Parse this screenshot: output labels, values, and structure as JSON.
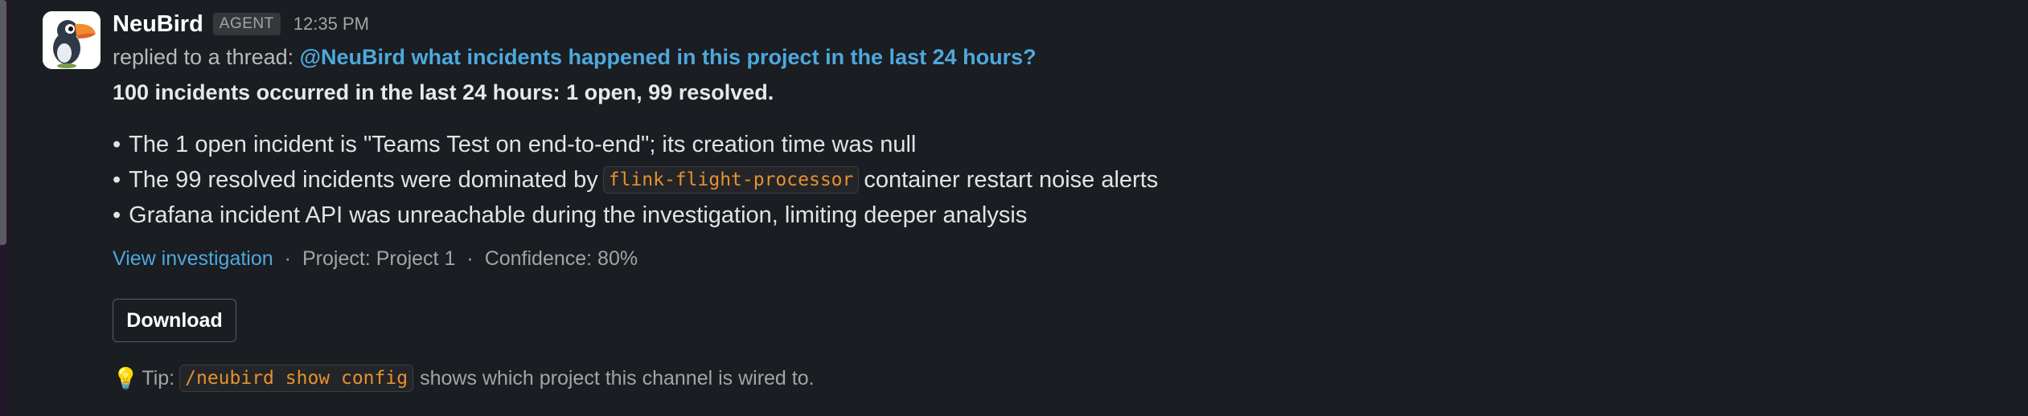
{
  "message": {
    "sender": "NeuBird",
    "badge": "AGENT",
    "time": "12:35 PM",
    "thread_prefix": "replied to a thread:",
    "thread_link": "@NeuBird what incidents happened in this project in the last 24 hours?",
    "summary": "100 incidents occurred in the last 24 hours: 1 open, 99 resolved.",
    "bullets": [
      {
        "text": "The 1 open incident is \"Teams Test on end-to-end\"; its creation time was null"
      },
      {
        "pre": "The 99 resolved incidents were dominated by",
        "code": "flink-flight-processor",
        "post": "container restart noise alerts"
      },
      {
        "text": "Grafana incident API was unreachable during the investigation, limiting deeper analysis"
      }
    ],
    "bullet_char": "•",
    "meta": {
      "link": "View investigation",
      "separator": "·",
      "project": "Project: Project 1",
      "confidence": "Confidence: 80%"
    },
    "download_label": "Download",
    "tip": {
      "icon": "lightbulb-icon",
      "icon_glyph": "💡",
      "label": "Tip:",
      "command": "/neubird show config",
      "rest": "shows which project this channel is wired to."
    }
  },
  "colors": {
    "background": "#1a1d21",
    "link": "#4ea8dd",
    "code": "#e8912d"
  }
}
